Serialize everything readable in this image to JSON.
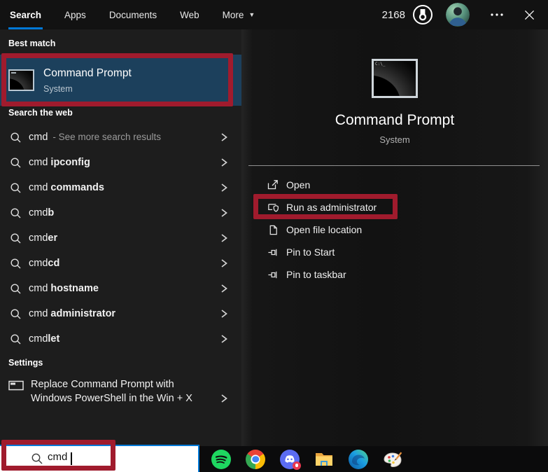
{
  "header": {
    "tabs": [
      {
        "label": "Search"
      },
      {
        "label": "Apps"
      },
      {
        "label": "Documents"
      },
      {
        "label": "Web"
      },
      {
        "label": "More"
      }
    ],
    "rewards_points": "2168",
    "icons": {
      "more_arrow": "▼",
      "ellipsis": "…"
    }
  },
  "left_panel": {
    "best_match_label": "Best match",
    "best_match": {
      "title": "Command Prompt",
      "subtitle": "System"
    },
    "web_label": "Search the web",
    "web_results": [
      {
        "base": "cmd",
        "bold": "",
        "note": "- See more search results"
      },
      {
        "base": "cmd ",
        "bold": "ipconfig",
        "note": ""
      },
      {
        "base": "cmd ",
        "bold": "commands",
        "note": ""
      },
      {
        "base": "cmd",
        "bold": "b",
        "note": ""
      },
      {
        "base": "cmd",
        "bold": "er",
        "note": ""
      },
      {
        "base": "cmd",
        "bold": "cd",
        "note": ""
      },
      {
        "base": "cmd ",
        "bold": "hostname",
        "note": ""
      },
      {
        "base": "cmd ",
        "bold": "administrator",
        "note": ""
      },
      {
        "base": "cmd",
        "bold": "let",
        "note": ""
      }
    ],
    "settings_label": "Settings",
    "settings_item": {
      "line1": "Replace Command Prompt with",
      "line2": "Windows PowerShell in the Win + X"
    }
  },
  "preview_panel": {
    "app_title": "Command Prompt",
    "app_subtitle": "System",
    "cmd_prompt_glyph": "C:\\_",
    "actions": [
      {
        "label": "Open"
      },
      {
        "label": "Run as administrator"
      },
      {
        "label": "Open file location"
      },
      {
        "label": "Pin to Start"
      },
      {
        "label": "Pin to taskbar"
      }
    ]
  },
  "search_box": {
    "value": "cmd"
  },
  "colors": {
    "accent": "#0078d7",
    "best_match_highlight": "#1c405c",
    "annotation_red": "#a01b2d"
  }
}
